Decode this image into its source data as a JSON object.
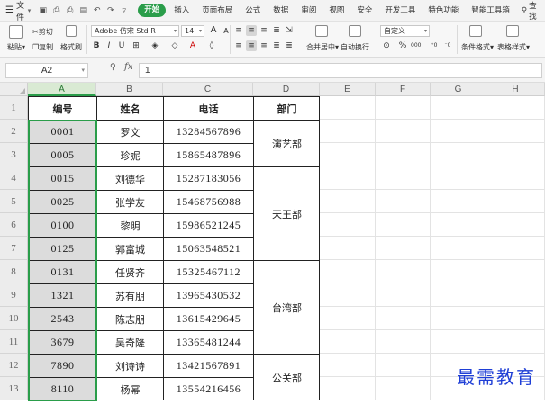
{
  "menubar": {
    "file_label": "文件",
    "tabs": [
      "开始",
      "插入",
      "页面布局",
      "公式",
      "数据",
      "审阅",
      "视图",
      "安全",
      "开发工具",
      "特色功能",
      "智能工具箱"
    ],
    "active_tab": "开始",
    "search_label": "查找",
    "accent_color": "#2a9d4a"
  },
  "ribbon": {
    "paste_label": "粘贴",
    "cut_label": "剪切",
    "copy_label": "复制",
    "format_painter_label": "格式刷",
    "font_name": "Adobe 仿宋 Std R",
    "font_size": "14",
    "increase_font": "A",
    "decrease_font": "A",
    "bold": "B",
    "italic": "I",
    "underline": "U",
    "merge_label": "合并居中",
    "wrap_label": "自动换行",
    "number_format": "自定义",
    "percent": "%",
    "thousands": "000",
    "conditional_label": "条件格式",
    "table_style_label": "表格样式"
  },
  "formula_bar": {
    "name_box": "A2",
    "fx_label": "fx",
    "value": "1"
  },
  "grid": {
    "columns": [
      "A",
      "B",
      "C",
      "D",
      "E",
      "F",
      "G",
      "H"
    ],
    "rows": [
      "1",
      "2",
      "3",
      "4",
      "5",
      "6",
      "7",
      "8",
      "9",
      "10",
      "11",
      "12",
      "13"
    ],
    "selected_column": "A",
    "headers": [
      "编号",
      "姓名",
      "电话",
      "部门"
    ],
    "records": [
      {
        "code": "0001",
        "name": "罗文",
        "phone": "13284567896"
      },
      {
        "code": "0005",
        "name": "珍妮",
        "phone": "15865487896"
      },
      {
        "code": "0015",
        "name": "刘德华",
        "phone": "15287183056"
      },
      {
        "code": "0025",
        "name": "张学友",
        "phone": "15468756988"
      },
      {
        "code": "0100",
        "name": "黎明",
        "phone": "15986521245"
      },
      {
        "code": "0125",
        "name": "郭富城",
        "phone": "15063548521"
      },
      {
        "code": "0131",
        "name": "任贤齐",
        "phone": "15325467112"
      },
      {
        "code": "1321",
        "name": "苏有朋",
        "phone": "13965430532"
      },
      {
        "code": "2543",
        "name": "陈志朋",
        "phone": "13615429645"
      },
      {
        "code": "3679",
        "name": "吴奇隆",
        "phone": "13365481244"
      },
      {
        "code": "7890",
        "name": "刘诗诗",
        "phone": "13421567891"
      },
      {
        "code": "8110",
        "name": "杨幂",
        "phone": "13554216456"
      }
    ],
    "departments": [
      "演艺部",
      "天王部",
      "台湾部",
      "公关部"
    ]
  },
  "watermark": "最需教育"
}
